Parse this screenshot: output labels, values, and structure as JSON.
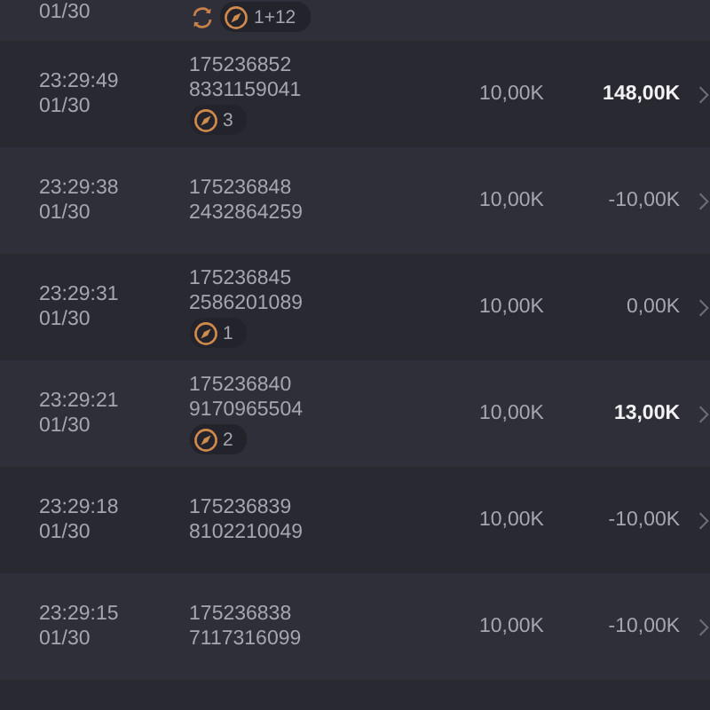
{
  "partial_row": {
    "date": "01/30",
    "badges": [
      {
        "kind": "refresh"
      },
      {
        "kind": "bonus",
        "count": "1+12"
      }
    ]
  },
  "rows": [
    {
      "time": "23:29:49",
      "date": "01/30",
      "round_id": [
        "175236852",
        "8331159041"
      ],
      "badges": [
        {
          "kind": "bonus",
          "count": "3"
        }
      ],
      "bet": "10,00K",
      "win": "148,00K",
      "highlight": true
    },
    {
      "time": "23:29:38",
      "date": "01/30",
      "round_id": [
        "175236848",
        "2432864259"
      ],
      "bet": "10,00K",
      "win": "-10,00K",
      "highlight": false
    },
    {
      "time": "23:29:31",
      "date": "01/30",
      "round_id": [
        "175236845",
        "2586201089"
      ],
      "badges": [
        {
          "kind": "bonus",
          "count": "1"
        }
      ],
      "bet": "10,00K",
      "win": "0,00K",
      "highlight": false
    },
    {
      "time": "23:29:21",
      "date": "01/30",
      "round_id": [
        "175236840",
        "9170965504"
      ],
      "badges": [
        {
          "kind": "bonus",
          "count": "2"
        }
      ],
      "bet": "10,00K",
      "win": "13,00K",
      "highlight": true
    },
    {
      "time": "23:29:18",
      "date": "01/30",
      "round_id": [
        "175236839",
        "8102210049"
      ],
      "bet": "10,00K",
      "win": "-10,00K",
      "highlight": false
    },
    {
      "time": "23:29:15",
      "date": "01/30",
      "round_id": [
        "175236838",
        "7117316099"
      ],
      "bet": "10,00K",
      "win": "-10,00K",
      "highlight": false
    }
  ]
}
